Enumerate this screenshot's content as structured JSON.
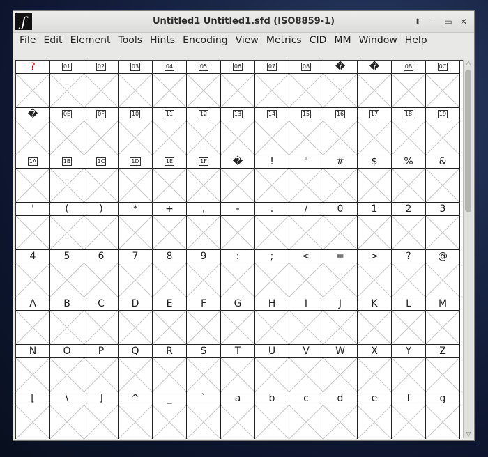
{
  "window": {
    "title": "Untitled1  Untitled1.sfd (ISO8859-1)",
    "app_icon_glyph": "ƒ",
    "controls": [
      {
        "name": "window-menu-icon",
        "glyph": "⬆"
      },
      {
        "name": "minimize-icon",
        "glyph": "–"
      },
      {
        "name": "maximize-icon",
        "glyph": "▭"
      },
      {
        "name": "close-icon",
        "glyph": "✕"
      }
    ]
  },
  "menubar": [
    "File",
    "Edit",
    "Element",
    "Tools",
    "Hints",
    "Encoding",
    "View",
    "Metrics",
    "CID",
    "MM",
    "Window",
    "Help"
  ],
  "grid": {
    "rows": [
      [
        "?",
        "01",
        "02",
        "03",
        "04",
        "05",
        "06",
        "07",
        "08",
        "�",
        "�",
        "0B",
        "0C"
      ],
      [
        "�",
        "0E",
        "0F",
        "10",
        "11",
        "12",
        "13",
        "14",
        "15",
        "16",
        "17",
        "18",
        "19"
      ],
      [
        "1A",
        "1B",
        "1C",
        "1D",
        "1E",
        "1F",
        "�",
        "!",
        "\"",
        "#",
        "$",
        "%",
        "&"
      ],
      [
        "'",
        "(",
        ")",
        "*",
        "+",
        ",",
        "-",
        ".",
        "/",
        "0",
        "1",
        "2",
        "3"
      ],
      [
        "4",
        "5",
        "6",
        "7",
        "8",
        "9",
        ":",
        ";",
        "<",
        "=",
        ">",
        "?",
        "@"
      ],
      [
        "A",
        "B",
        "C",
        "D",
        "E",
        "F",
        "G",
        "H",
        "I",
        "J",
        "K",
        "L",
        "M"
      ],
      [
        "N",
        "O",
        "P",
        "Q",
        "R",
        "S",
        "T",
        "U",
        "V",
        "W",
        "X",
        "Y",
        "Z"
      ],
      [
        "[",
        "\\",
        "]",
        "^",
        "_",
        "`",
        "a",
        "b",
        "c",
        "d",
        "e",
        "f",
        "g"
      ]
    ],
    "hex_box_labels": [
      "01",
      "02",
      "03",
      "04",
      "05",
      "06",
      "07",
      "08",
      "0B",
      "0C",
      "0E",
      "0F",
      "10",
      "11",
      "12",
      "13",
      "14",
      "15",
      "16",
      "17",
      "18",
      "19",
      "1A",
      "1B",
      "1C",
      "1D",
      "1E",
      "1F"
    ],
    "red_label_positions": [
      [
        0,
        0
      ]
    ]
  },
  "colors": {
    "missing_glyph_red": "#d01010",
    "empty_glyph_cross": "#c8c8c8"
  }
}
